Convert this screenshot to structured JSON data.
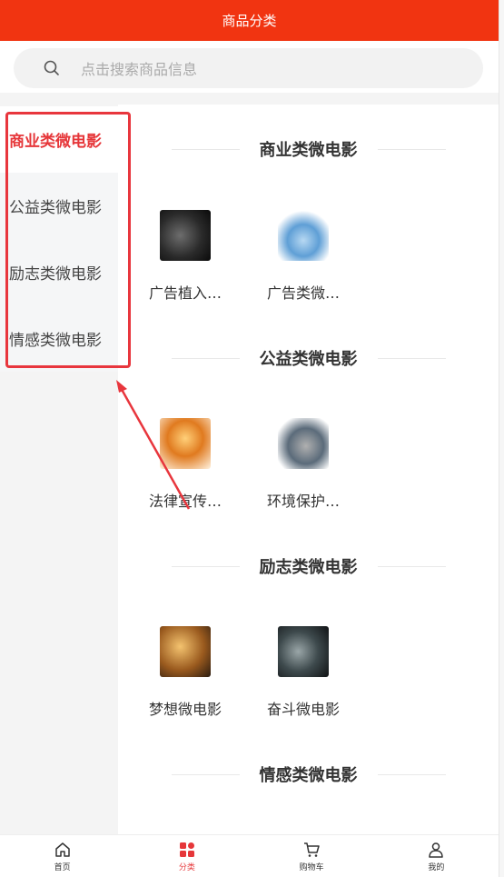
{
  "header": {
    "title": "商品分类"
  },
  "search": {
    "placeholder": "点击搜索商品信息"
  },
  "sidebar": {
    "items": [
      {
        "label": "商业类微电影"
      },
      {
        "label": "公益类微电影"
      },
      {
        "label": "励志类微电影"
      },
      {
        "label": "情感类微电影"
      }
    ]
  },
  "sections": [
    {
      "title": "商业类微电影",
      "products": [
        {
          "name": "广告植入…",
          "thumb": "film-camera-icon"
        },
        {
          "name": "广告类微…",
          "thumb": "film-reel-icon"
        }
      ]
    },
    {
      "title": "公益类微电影",
      "products": [
        {
          "name": "法律宣传…",
          "thumb": "3d-film-icon"
        },
        {
          "name": "环境保护…",
          "thumb": "film-clapper-icon"
        }
      ]
    },
    {
      "title": "励志类微电影",
      "products": [
        {
          "name": "梦想微电影",
          "thumb": "film-strip-icon"
        },
        {
          "name": "奋斗微电影",
          "thumb": "record-player-icon"
        }
      ]
    },
    {
      "title": "情感类微电影",
      "products": []
    }
  ],
  "tabbar": {
    "items": [
      {
        "label": "首页",
        "icon": "home-icon"
      },
      {
        "label": "分类",
        "icon": "category-icon"
      },
      {
        "label": "购物车",
        "icon": "cart-icon"
      },
      {
        "label": "我的",
        "icon": "user-icon"
      }
    ]
  },
  "colors": {
    "brand": "#f13411",
    "accent": "#e6373a"
  }
}
